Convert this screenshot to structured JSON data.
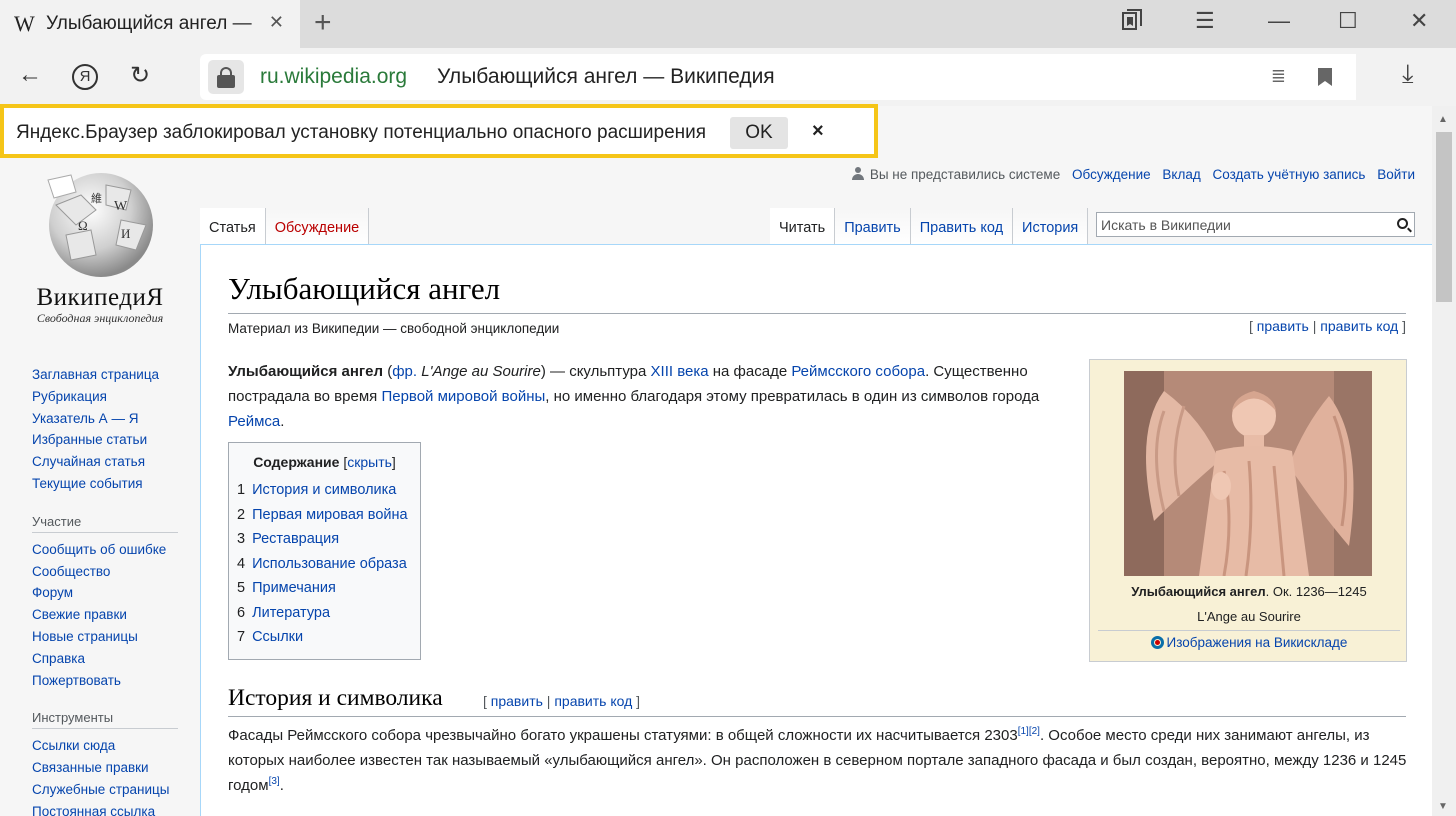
{
  "browser": {
    "tab_favicon": "W",
    "tab_title": "Улыбающийся ангел — Википедия",
    "tab_close": "✕",
    "new_tab": "+",
    "window": {
      "bookmarks_icon": "bookmarks-icon",
      "menu": "☰",
      "minimize": "—",
      "maximize": "☐",
      "close": "✕"
    },
    "nav": {
      "back": "←",
      "yandex": "Я",
      "reload": "↻"
    },
    "omnibox": {
      "domain": "ru.wikipedia.org",
      "title": "Улыбающийся ангел — Википедия",
      "reader": "≣"
    },
    "download": "⤓",
    "notification": {
      "text": "Яндекс.Браузер заблокировал установку потенциально опасного расширения",
      "ok_label": "OK",
      "close": "×",
      "highlight_color": "#f5c518"
    }
  },
  "wiki": {
    "logo_word": "ВикипедиЯ",
    "logo_tagline": "Свободная энциклопедия",
    "personal": {
      "anon": "Вы не представились системе",
      "talk": "Обсуждение",
      "contrib": "Вклад",
      "create": "Создать учётную запись",
      "login": "Войти"
    },
    "sidebar": {
      "main": [
        "Заглавная страница",
        "Рубрикация",
        "Указатель А — Я",
        "Избранные статьи",
        "Случайная статья",
        "Текущие события"
      ],
      "participation_heading": "Участие",
      "participation": [
        "Сообщить об ошибке",
        "Сообщество",
        "Форум",
        "Свежие правки",
        "Новые страницы",
        "Справка",
        "Пожертвовать"
      ],
      "tools_heading": "Инструменты",
      "tools": [
        "Ссылки сюда",
        "Связанные правки",
        "Служебные страницы",
        "Постоянная ссылка"
      ]
    },
    "tabs": {
      "article": "Статья",
      "talk": "Обсуждение",
      "read": "Читать",
      "edit": "Править",
      "edit_source": "Править код",
      "history": "История"
    },
    "search_placeholder": "Искать в Википедии",
    "title": "Улыбающийся ангел",
    "site_sub": "Материал из Википедии — свободной энциклопедии",
    "edit_links": {
      "open": "[",
      "edit": "править",
      "sep": "|",
      "edit_source": "править код",
      "close": "]"
    },
    "intro": {
      "bold": "Улыбающийся ангел",
      "t1": " (",
      "lang": "фр.",
      "t2": " ",
      "orig": "L'Ange au Sourire",
      "t3": ") — скульптура ",
      "l1": "XIII века",
      "t4": " на фасаде ",
      "l2": "Реймсского собора",
      "t5": ". Существенно пострадала во время ",
      "l3": "Первой мировой войны",
      "t6": ", но именно благодаря этому превратилась в один из символов города ",
      "l4": "Реймса",
      "t7": "."
    },
    "toc": {
      "title": "Содержание",
      "toggle_open": "[",
      "toggle": "скрыть",
      "toggle_close": "]",
      "items": [
        {
          "num": "1",
          "label": "История и символика"
        },
        {
          "num": "2",
          "label": "Первая мировая война"
        },
        {
          "num": "3",
          "label": "Реставрация"
        },
        {
          "num": "4",
          "label": "Использование образа"
        },
        {
          "num": "5",
          "label": "Примечания"
        },
        {
          "num": "6",
          "label": "Литература"
        },
        {
          "num": "7",
          "label": "Ссылки"
        }
      ]
    },
    "infobox": {
      "caption_bold": "Улыбающийся ангел",
      "caption_rest": ". Ок. 1236—1245",
      "caption_orig": "L'Ange au Sourire",
      "commons": "Изображения на Викискладе"
    },
    "section1": {
      "heading": "История и символика",
      "edit_open": "[",
      "edit": "править",
      "sep": "|",
      "edit_source": "править код",
      "edit_close": "]",
      "p1": "Фасады Реймсского собора чрезвычайно богато украшены статуями: в общей сложности их насчитывается 2303",
      "ref1": "[1]",
      "ref2": "[2]",
      "p2": ". Особое место среди них занимают ангелы, из которых наиболее известен так называемый «улыбающийся ангел». Он расположен в северном портале западного фасада и был создан, вероятно, между 1236 и 1245 годом",
      "ref3": "[3]",
      "p3": "."
    }
  }
}
